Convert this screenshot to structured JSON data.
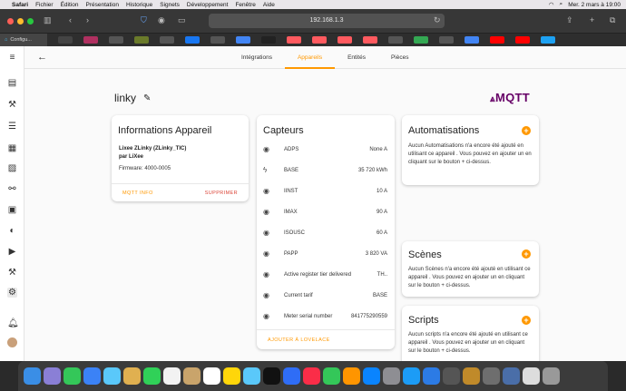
{
  "menubar": {
    "items": [
      "Safari",
      "Fichier",
      "Édition",
      "Présentation",
      "Historique",
      "Signets",
      "Développement",
      "Fenêtre",
      "Aide"
    ],
    "clock": "Mer. 2 mars à 19:00"
  },
  "browser": {
    "address": "192.168.1.3",
    "current_tab": "Configu..."
  },
  "nav": {
    "tabs": [
      "Intégrations",
      "Appareils",
      "Entités",
      "Pièces"
    ],
    "active_tab": 1
  },
  "device": {
    "name": "linky",
    "brand_logo": "MQTT"
  },
  "info_card": {
    "title": "Informations Appareil",
    "model": "Lixee ZLinky (ZLinky_TIC)",
    "by": "par LiXee",
    "firmware": "Firmware: 4000-0005",
    "btn_mqtt": "MQTT INFO",
    "btn_delete": "SUPPRIMER"
  },
  "sensors": {
    "title": "Capteurs",
    "rows": [
      {
        "icon": "eye-icon",
        "name": "ADPS",
        "value": "None A"
      },
      {
        "icon": "flash-icon",
        "name": "BASE",
        "value": "35 720 kWh"
      },
      {
        "icon": "eye-icon",
        "name": "IINST",
        "value": "10 A"
      },
      {
        "icon": "eye-icon",
        "name": "IMAX",
        "value": "90 A"
      },
      {
        "icon": "eye-icon",
        "name": "ISOUSC",
        "value": "60 A"
      },
      {
        "icon": "eye-icon",
        "name": "PAPP",
        "value": "3 820 VA"
      },
      {
        "icon": "eye-icon",
        "name": "Active register tier delivered",
        "value": "TH.."
      },
      {
        "icon": "eye-icon",
        "name": "Current tarif",
        "value": "BASE"
      },
      {
        "icon": "eye-icon",
        "name": "Meter serial number",
        "value": "841775290559"
      }
    ],
    "btn_lovelace": "AJOUTER À LOVELACE"
  },
  "automations": {
    "title": "Automatisations",
    "desc": "Aucun Automatisations n'a encore été ajouté en utilisant ce appareil . Vous pouvez en ajouter un en cliquant sur le bouton + ci-dessus."
  },
  "scenes": {
    "title": "Scènes",
    "desc": "Aucun Scènes n'a encore été ajouté en utilisant ce appareil . Vous pouvez en ajouter un en cliquant sur le bouton + ci-dessus."
  },
  "scripts": {
    "title": "Scripts",
    "desc": "Aucun scripts n'a encore été ajouté en utilisant ce appareil . Vous pouvez en ajouter un en cliquant sur le bouton + ci-dessus."
  },
  "colors": {
    "accent": "#ff9800",
    "danger": "#db4437",
    "mqtt": "#660066"
  }
}
